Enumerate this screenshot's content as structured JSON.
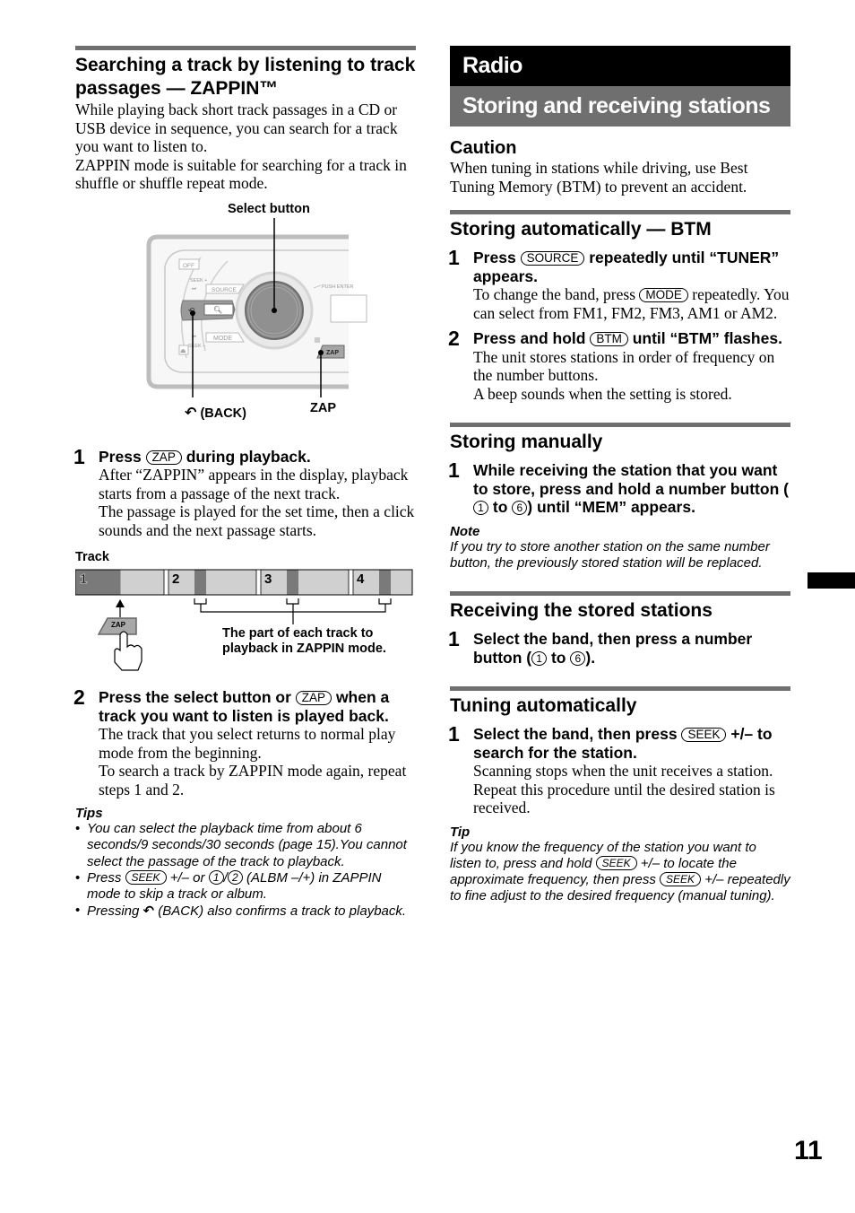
{
  "left": {
    "heading": "Searching a track by listening to track passages — ZAPPIN™",
    "intro": [
      "While playing back short track passages in a CD or USB device in sequence, you can search for a track you want to listen to.",
      "ZAPPIN mode is suitable for searching for a track in shuffle or shuffle repeat mode."
    ],
    "figure1": {
      "select_button_label": "Select button",
      "back_label": "(BACK)",
      "zap_label": "ZAP",
      "device_labels": {
        "off": "OFF",
        "seek_plus": "SEEK +",
        "source": "SOURCE",
        "push_enter": "PUSH ENTER",
        "mode": "MODE",
        "seek_minus": "SEEK –",
        "zap": "ZAP"
      }
    },
    "step1": {
      "num": "1",
      "title_pre": "Press",
      "key": "ZAP",
      "title_post": "during playback.",
      "body": [
        "After “ZAPPIN” appears in the display, playback starts from a passage of the next track.",
        "The passage is played for the set time, then a click sounds and the next passage starts."
      ]
    },
    "figure2": {
      "track_label": "Track",
      "tracks": [
        "1",
        "2",
        "3",
        "4"
      ],
      "zap_key": "ZAP",
      "caption_line1": "The part of each track to",
      "caption_line2": "playback in ZAPPIN mode."
    },
    "step2": {
      "num": "2",
      "title_pre": "Press the select button or",
      "key": "ZAP",
      "title_post": "when a track you want to listen is played back.",
      "body": [
        "The track that you select returns to normal play mode from the beginning.",
        "To search a track by ZAPPIN mode again, repeat steps 1 and 2."
      ]
    },
    "tips": {
      "heading": "Tips",
      "tip1": "You can select the playback time from about 6 seconds/9 seconds/30 seconds (page 15).You cannot select the passage of the track to playback.",
      "tip2_pre": "Press",
      "tip2_key": "SEEK",
      "tip2_mid": "+/– or",
      "tip2_key1": "1",
      "tip2_slash": "/",
      "tip2_key2": "2",
      "tip2_post": "(ALBM –/+) in ZAPPIN mode to skip a track or album.",
      "tip3_pre": "Pressing",
      "tip3_post": "(BACK) also confirms a track to playback."
    }
  },
  "right": {
    "chapter": "Radio",
    "section": "Storing and receiving stations",
    "caution": {
      "heading": "Caution",
      "text": "When tuning in stations while driving, use Best Tuning Memory (BTM) to prevent an accident."
    },
    "btm": {
      "heading": "Storing automatically — BTM",
      "step1": {
        "num": "1",
        "pre": "Press",
        "key": "SOURCE",
        "post": "repeatedly until “TUNER” appears.",
        "body_pre": "To change the band, press",
        "body_key": "MODE",
        "body_post": "repeatedly. You can select from FM1, FM2, FM3, AM1 or AM2."
      },
      "step2": {
        "num": "2",
        "pre": "Press and hold",
        "key": "BTM",
        "post": "until “BTM” flashes.",
        "body": [
          "The unit stores stations in order of frequency on the number buttons.",
          "A beep sounds when the setting is stored."
        ]
      }
    },
    "manual": {
      "heading": "Storing manually",
      "step1": {
        "num": "1",
        "pre": "While receiving the station that you want to store, press and hold a number button (",
        "key1": "1",
        "mid": "to",
        "key2": "6",
        "post": ") until “MEM” appears."
      },
      "note_heading": "Note",
      "note": "If you try to store another station on the same number button, the previously stored station will be replaced."
    },
    "receiving": {
      "heading": "Receiving the stored stations",
      "step1": {
        "num": "1",
        "pre": "Select the band, then press a number button (",
        "key1": "1",
        "mid": "to",
        "key2": "6",
        "post": ")."
      }
    },
    "tuning": {
      "heading": "Tuning automatically",
      "step1": {
        "num": "1",
        "pre": "Select the band, then press",
        "key": "SEEK",
        "post": "+/– to search for the station.",
        "body": "Scanning stops when the unit receives a station. Repeat this procedure until the desired station is received."
      },
      "tip_heading": "Tip",
      "tip_pre": "If you know the frequency of the station you want to listen to, press and hold",
      "tip_key1": "SEEK",
      "tip_mid": "+/– to locate the approximate frequency, then press",
      "tip_key2": "SEEK",
      "tip_post": "+/– repeatedly to fine adjust to the desired frequency (manual tuning)."
    }
  },
  "page_number": "11"
}
